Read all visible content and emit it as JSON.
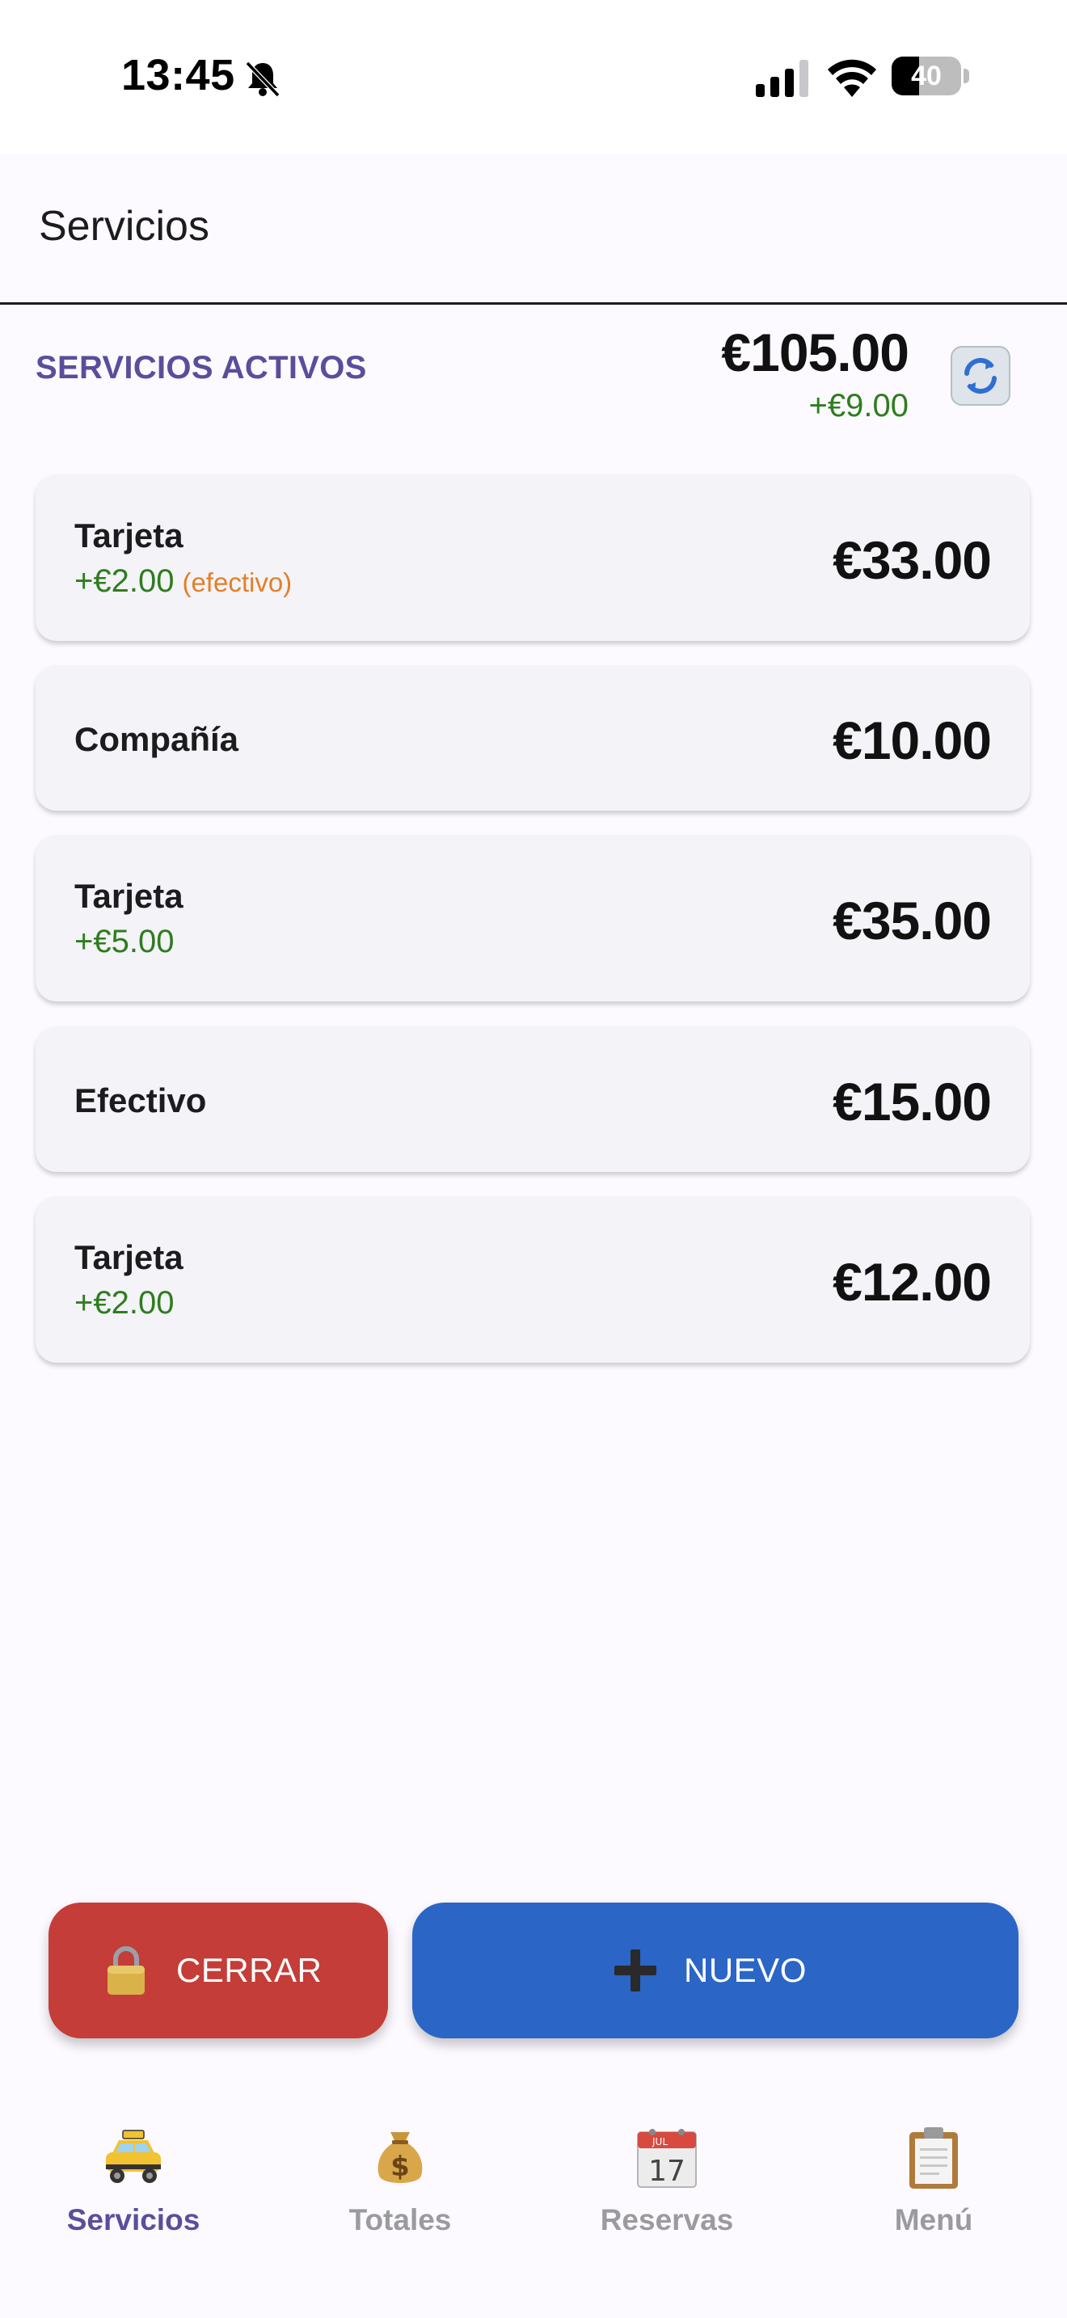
{
  "status_bar": {
    "time": "13:45",
    "battery": "40",
    "battery_level": 0.4
  },
  "header": {
    "title": "Servicios"
  },
  "summary": {
    "section_title": "SERVICIOS ACTIVOS",
    "total": "€105.00",
    "extra": "+€9.00",
    "refresh_icon": "refresh-icon"
  },
  "services": [
    {
      "method": "Tarjeta",
      "tip": "+€2.00",
      "note": "(efectivo)",
      "amount": "€33.00"
    },
    {
      "method": "Compañía",
      "tip": "",
      "note": "",
      "amount": "€10.00"
    },
    {
      "method": "Tarjeta",
      "tip": "+€5.00",
      "note": "",
      "amount": "€35.00"
    },
    {
      "method": "Efectivo",
      "tip": "",
      "note": "",
      "amount": "€15.00"
    },
    {
      "method": "Tarjeta",
      "tip": "+€2.00",
      "note": "",
      "amount": "€12.00"
    }
  ],
  "actions": {
    "close_label": "CERRAR",
    "new_label": "NUEVO",
    "close_icon": "lock-icon",
    "new_icon": "plus-icon"
  },
  "tabs": [
    {
      "label": "Servicios",
      "icon": "taxi-icon",
      "active": true
    },
    {
      "label": "Totales",
      "icon": "money-bag-icon",
      "active": false
    },
    {
      "label": "Reservas",
      "icon": "calendar-icon",
      "active": false,
      "calendar_month": "JUL",
      "calendar_day": "17"
    },
    {
      "label": "Menú",
      "icon": "clipboard-icon",
      "active": false
    }
  ],
  "colors": {
    "accent": "#5a4e9c",
    "positive": "#2e7d1e",
    "note": "#e0802a",
    "close_button": "#c43d38",
    "new_button": "#2b65c6"
  }
}
